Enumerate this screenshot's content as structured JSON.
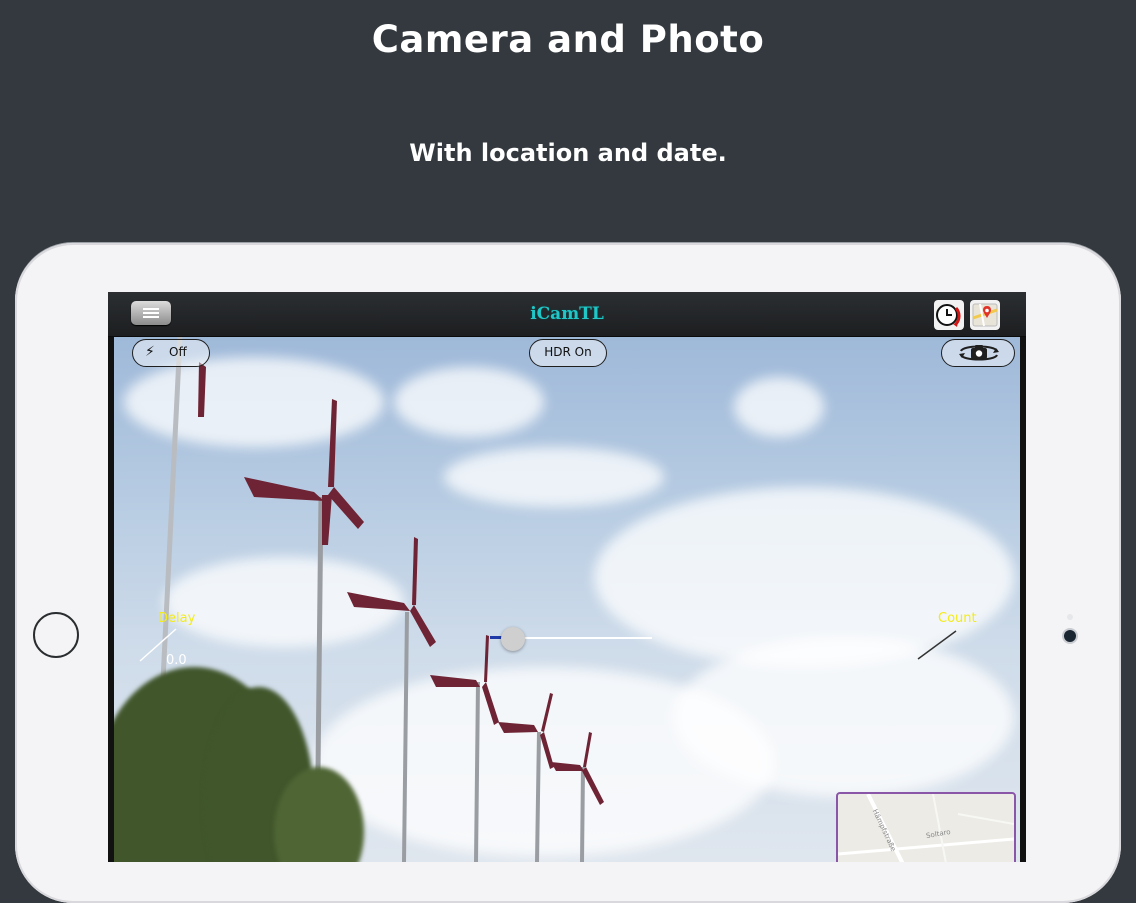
{
  "promo": {
    "headline": "Camera and Photo",
    "subheadline": "With location and date."
  },
  "app": {
    "title": "iCamTL",
    "title_color": "#1fc7c7",
    "navbar": {
      "menu_icon": "hamburger-icon",
      "right_icons": [
        "clock-icon",
        "map-icon"
      ]
    },
    "camera_controls": {
      "flash": {
        "icon": "lightning-icon",
        "label": "Off"
      },
      "hdr_label": "HDR On",
      "switch_camera_icon": "camera-rotate-icon",
      "delay": {
        "label": "Delay",
        "value": "0.0"
      },
      "count": {
        "label": "Count"
      },
      "label_color": "#f4ec1a",
      "slider_value": 0.1
    },
    "minimap": {
      "streets": [
        "Hämpfstraße",
        "Soltaro"
      ],
      "border_color": "#8a56a8"
    }
  }
}
